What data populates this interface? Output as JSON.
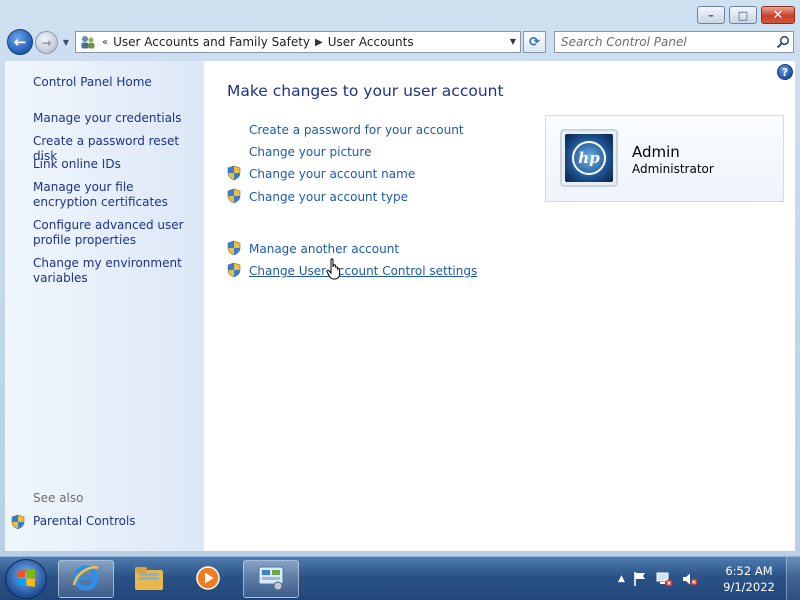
{
  "window": {
    "minimize_glyph": "–",
    "maximize_glyph": "□",
    "close_glyph": "✕"
  },
  "navigation": {
    "back_glyph": "←",
    "forward_glyph": "→",
    "history_dropdown_glyph": "▼"
  },
  "address_bar": {
    "overflow_glyph": "«",
    "separator_glyph": "▶",
    "breadcrumbs": [
      "User Accounts and Family Safety",
      "User Accounts"
    ],
    "dropdown_glyph": "▼",
    "refresh_glyph": "⟳"
  },
  "search": {
    "placeholder": "Search Control Panel"
  },
  "sidebar": {
    "home": "Control Panel Home",
    "links": [
      "Manage your credentials",
      "Create a password reset disk",
      "Link online IDs",
      "Manage your file encryption certificates",
      "Configure advanced user profile properties",
      "Change my environment variables"
    ],
    "see_also_label": "See also",
    "see_also_links": [
      "Parental Controls"
    ]
  },
  "main": {
    "title": "Make changes to your user account",
    "help_glyph": "?",
    "tasks": [
      {
        "label": "Create a password for your account",
        "shield": false
      },
      {
        "label": "Change your picture",
        "shield": false
      },
      {
        "label": "Change your account name",
        "shield": true
      },
      {
        "label": "Change your account type",
        "shield": true
      }
    ],
    "other_tasks": [
      {
        "label": "Manage another account",
        "shield": true
      },
      {
        "label": "Change User Account Control settings",
        "shield": true,
        "hovered": true
      }
    ]
  },
  "account": {
    "name": "Admin",
    "role": "Administrator",
    "picture_logo_text": "hp"
  },
  "taskbar": {
    "clock_time": "6:52 AM",
    "clock_date": "9/1/2022",
    "tray_overflow_glyph": "▲"
  },
  "colors": {
    "link": "#1e5aa8",
    "title": "#1e3287",
    "taskbar": "#2b5387"
  }
}
